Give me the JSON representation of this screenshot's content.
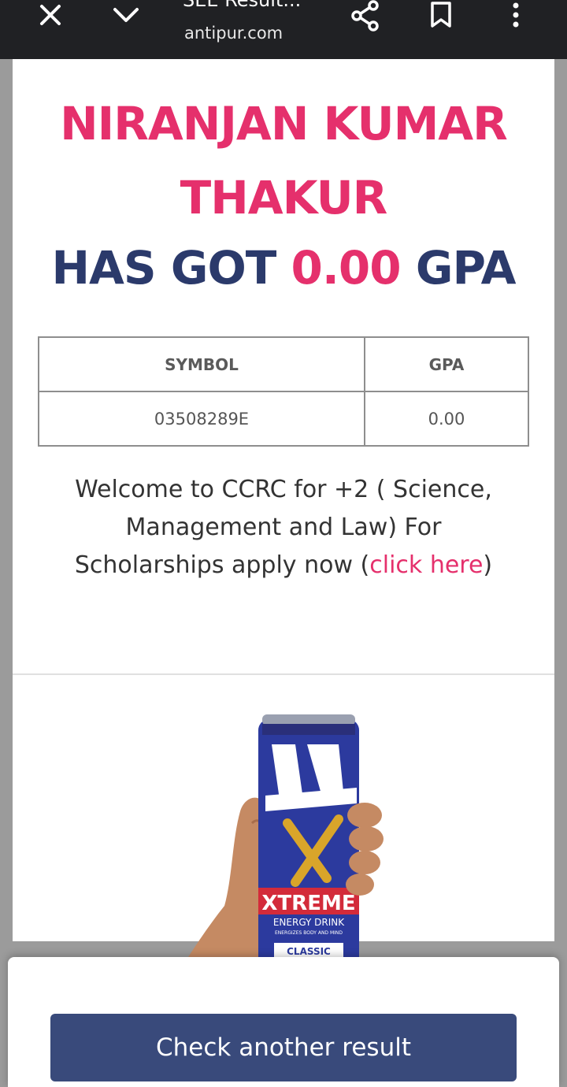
{
  "toolbar": {
    "title": "SEE Result...",
    "url": "antipur.com",
    "icons": [
      "close-icon",
      "chevron-down-icon",
      "share-icon",
      "bookmark-icon",
      "more-vertical-icon"
    ]
  },
  "result": {
    "name_line1": "NIRANJAN KUMAR",
    "name_line2": "THAKUR",
    "got_prefix": "HAS GOT ",
    "gpa_value": "0.00",
    "got_suffix": " GPA"
  },
  "table": {
    "headers": [
      "SYMBOL",
      "GPA"
    ],
    "rows": [
      [
        "03508289E",
        "0.00"
      ]
    ]
  },
  "welcome": {
    "text1": "Welcome to CCRC for +2 ( Science, Management and Law) For Scholarships apply now (",
    "link": "click here",
    "text2": ")"
  },
  "ad": {
    "brand": "XTREME",
    "subtitle": "ENERGY DRINK",
    "tagline": "ENERGIZES BODY AND MIND",
    "variant": "CLASSIC"
  },
  "actions": {
    "check_another": "Check another result"
  },
  "colors": {
    "accent_pink": "#e5306c",
    "navy": "#2b3a6b",
    "button": "#394a7b"
  }
}
